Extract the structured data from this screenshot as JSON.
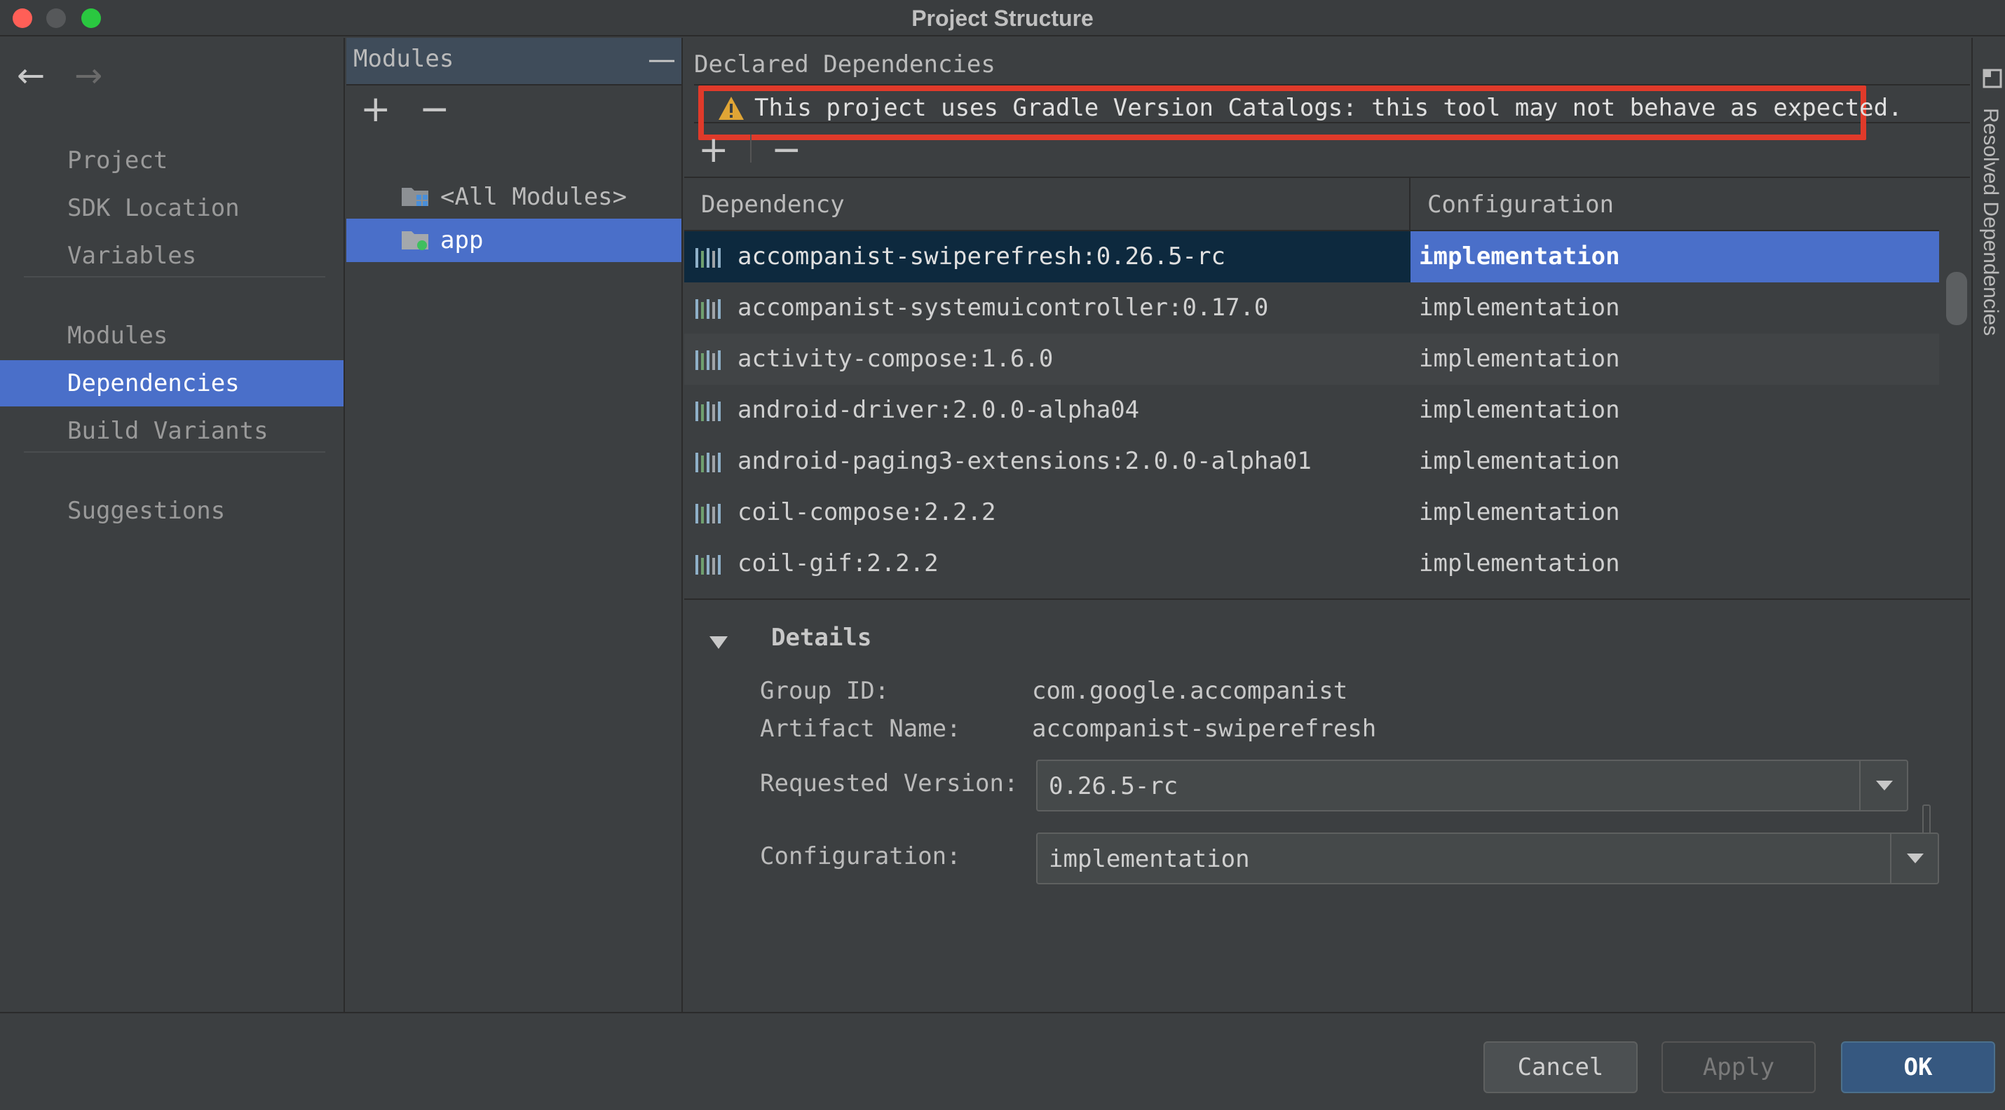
{
  "window": {
    "title": "Project Structure"
  },
  "nav": {
    "back_label": "←",
    "forward_label": "→",
    "items": [
      {
        "label": "Project"
      },
      {
        "label": "SDK Location"
      },
      {
        "label": "Variables"
      },
      {
        "label": "Modules"
      },
      {
        "label": "Dependencies"
      },
      {
        "label": "Build Variants"
      },
      {
        "label": "Suggestions"
      }
    ],
    "active": "Dependencies"
  },
  "modules_panel": {
    "title": "Modules",
    "collapse_label": "—",
    "add_label": "+",
    "remove_label": "−",
    "items": [
      {
        "label": "<All Modules>"
      },
      {
        "label": "app"
      }
    ],
    "selected": "app"
  },
  "dependencies_panel": {
    "title": "Declared Dependencies",
    "warning": "This project uses Gradle Version Catalogs: this tool may not behave as expected.",
    "add_label": "+",
    "remove_label": "−",
    "columns": {
      "dependency": "Dependency",
      "configuration": "Configuration"
    },
    "rows": [
      {
        "dependency": "accompanist-swiperefresh:0.26.5-rc",
        "configuration": "implementation"
      },
      {
        "dependency": "accompanist-systemuicontroller:0.17.0",
        "configuration": "implementation"
      },
      {
        "dependency": "activity-compose:1.6.0",
        "configuration": "implementation"
      },
      {
        "dependency": "android-driver:2.0.0-alpha04",
        "configuration": "implementation"
      },
      {
        "dependency": "android-paging3-extensions:2.0.0-alpha01",
        "configuration": "implementation"
      },
      {
        "dependency": "coil-compose:2.2.2",
        "configuration": "implementation"
      },
      {
        "dependency": "coil-gif:2.2.2",
        "configuration": "implementation"
      }
    ],
    "selected_row": 0
  },
  "details": {
    "title": "Details",
    "group_id_label": "Group ID:",
    "group_id": "com.google.accompanist",
    "artifact_label": "Artifact Name:",
    "artifact": "accompanist-swiperefresh",
    "requested_version_label": "Requested Version:",
    "requested_version": "0.26.5-rc",
    "configuration_label": "Configuration:",
    "configuration": "implementation"
  },
  "side_tab": {
    "label": "Resolved Dependencies"
  },
  "footer": {
    "cancel": "Cancel",
    "apply": "Apply",
    "ok": "OK"
  },
  "colors": {
    "accent": "#4a6fc9",
    "warning_outline": "#e03a2a",
    "background": "#3c3f41"
  }
}
